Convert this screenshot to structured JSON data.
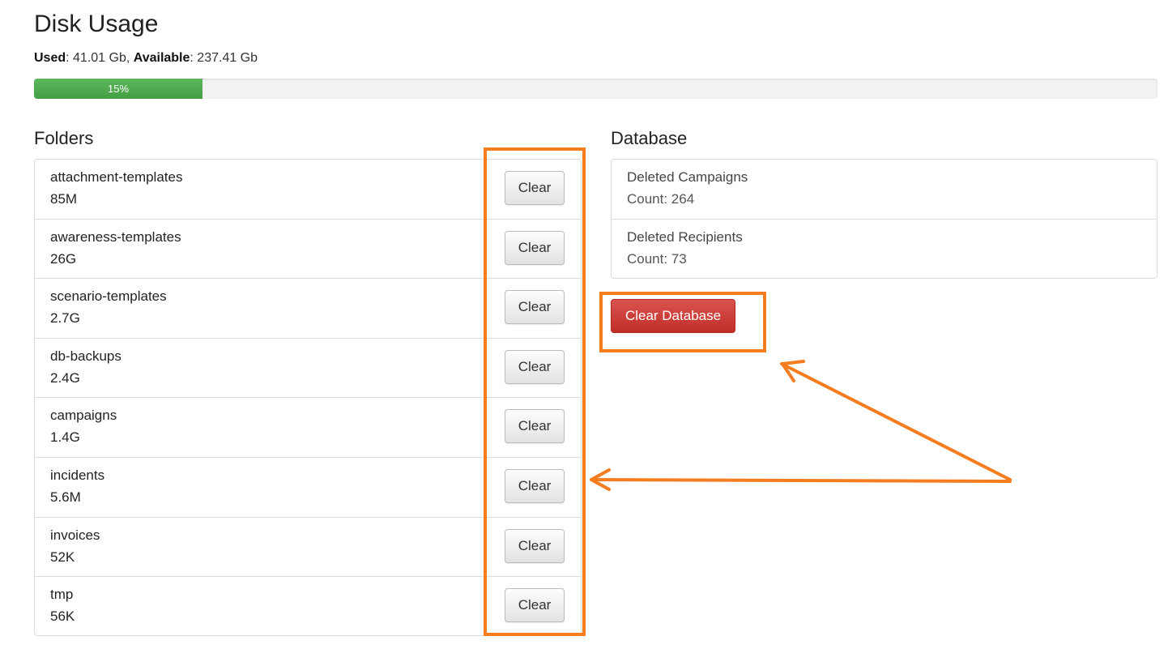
{
  "header": {
    "title": "Disk Usage",
    "used_label": "Used",
    "used_value": "41.01 Gb",
    "available_label": "Available",
    "available_value": "237.41 Gb",
    "progress_percent": 15,
    "progress_label": "15%",
    "progress_color": "#5cb85c"
  },
  "folders": {
    "title": "Folders",
    "clear_label": "Clear",
    "items": [
      {
        "name": "attachment-templates",
        "size": "85M"
      },
      {
        "name": "awareness-templates",
        "size": "26G"
      },
      {
        "name": "scenario-templates",
        "size": "2.7G"
      },
      {
        "name": "db-backups",
        "size": "2.4G"
      },
      {
        "name": "campaigns",
        "size": "1.4G"
      },
      {
        "name": "incidents",
        "size": "5.6M"
      },
      {
        "name": "invoices",
        "size": "52K"
      },
      {
        "name": "tmp",
        "size": "56K"
      }
    ]
  },
  "database": {
    "title": "Database",
    "items": [
      {
        "name": "Deleted Campaigns",
        "count": "Count: 264"
      },
      {
        "name": "Deleted Recipients",
        "count": "Count: 73"
      }
    ],
    "clear_button_label": "Clear Database",
    "danger_color": "#d9534f"
  },
  "annotation": {
    "color": "#f57c1f"
  }
}
